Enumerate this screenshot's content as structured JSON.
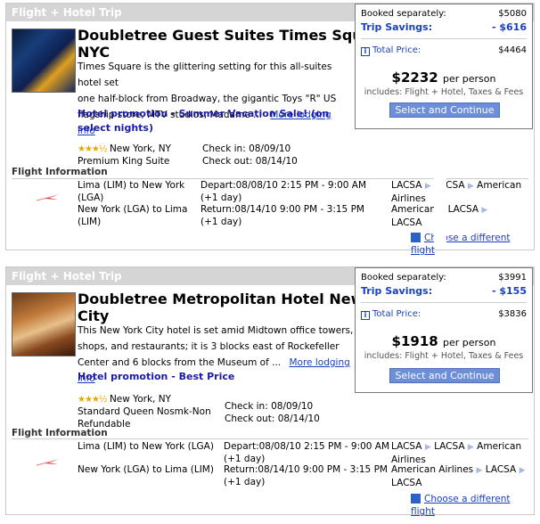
{
  "cards": [
    {
      "header": "Flight + Hotel Trip",
      "hotel_name_line1": "Doubletree Guest Suites Times Square",
      "hotel_name_line2": "NYC",
      "desc_line1": "Times Square is the glittering setting for this all-suites hotel set",
      "desc_line2": "one half-block from Broadway, the gigantic Toys \"R\" US",
      "desc_line3": "flagship store, MTV studios, Madame ...",
      "more_info": "More lodging info",
      "promo": "Hotel promotion - Summer Vacation Sale! (on select nights)",
      "stars": "★★★½",
      "location": "New York, NY",
      "room": "Premium King Suite",
      "checkin": "Check in: 08/09/10",
      "checkout": "Check out: 08/14/10",
      "flight_label": "Flight Information",
      "route1": "Lima (LIM) to New York",
      "route1b": "(LGA)",
      "route2": "New York (LGA) to Lima",
      "route2b": "(LIM)",
      "depart": "Depart:08/08/10  2:15 PM - 9:00 AM",
      "depart_plus": "(+1 day)",
      "return": "Return:08/14/10  9:00 PM - 3:15 PM",
      "return_plus": "(+1 day)",
      "airlines1a": "LACSA",
      "airlines1b": "LACSA",
      "airlines1c": "American",
      "airlines1d": "Airlines",
      "airlines2a": "American",
      "airlines2b": "LACSA",
      "airlines2c": "LACSA",
      "choose": "Choose a different flight",
      "price": {
        "booked_label": "Booked separately:",
        "booked_value": "$5080",
        "savings_label": "Trip Savings:",
        "savings_value": "- $616",
        "total_label": "Total Price:",
        "total_value": "$4464",
        "per_person": "$2232",
        "per_person_label": "per person",
        "includes": "includes: Flight + Hotel, Taxes & Fees",
        "button": "Select and Continue"
      }
    },
    {
      "header": "Flight + Hotel Trip",
      "hotel_name_line1": "Doubletree Metropolitan Hotel New York",
      "hotel_name_line2": "City",
      "desc_line1": "This New York City hotel is set amid Midtown office towers,",
      "desc_line2": "shops, and restaurants; it is 3 blocks east of Rockefeller",
      "desc_line3": "Center and 6 blocks from the Museum of ...",
      "more_info": "More lodging info",
      "promo": "Hotel promotion - Best Price",
      "stars": "★★★½",
      "location": "New York, NY",
      "room": "Standard Queen Nosmk-Non",
      "room2": "Refundable",
      "checkin": "Check in: 08/09/10",
      "checkout": "Check out: 08/14/10",
      "flight_label": "Flight Information",
      "route1": "Lima (LIM) to New York (LGA)",
      "route2": "New York (LGA) to Lima (LIM)",
      "depart": "Depart:08/08/10  2:15 PM - 9:00 AM",
      "depart_plus": "(+1 day)",
      "return": "Return:08/14/10  9:00 PM - 3:15 PM",
      "return_plus": "(+1 day)",
      "airlines1a": "LACSA",
      "airlines1b": "LACSA",
      "airlines1c": "American",
      "airlines1d": "Airlines",
      "airlines2a": "American Airlines",
      "airlines2b": "LACSA",
      "airlines2c": "LACSA",
      "choose": "Choose a different flight",
      "price": {
        "booked_label": "Booked separately:",
        "booked_value": "$3991",
        "savings_label": "Trip Savings:",
        "savings_value": "- $155",
        "total_label": "Total Price:",
        "total_value": "$3836",
        "per_person": "$1918",
        "per_person_label": "per person",
        "includes": "includes: Flight + Hotel, Taxes & Fees",
        "button": "Select and Continue"
      }
    }
  ],
  "colors": {
    "link": "#1a3fbf",
    "button": "#6d8ed8",
    "header": "#d5d5d5"
  }
}
